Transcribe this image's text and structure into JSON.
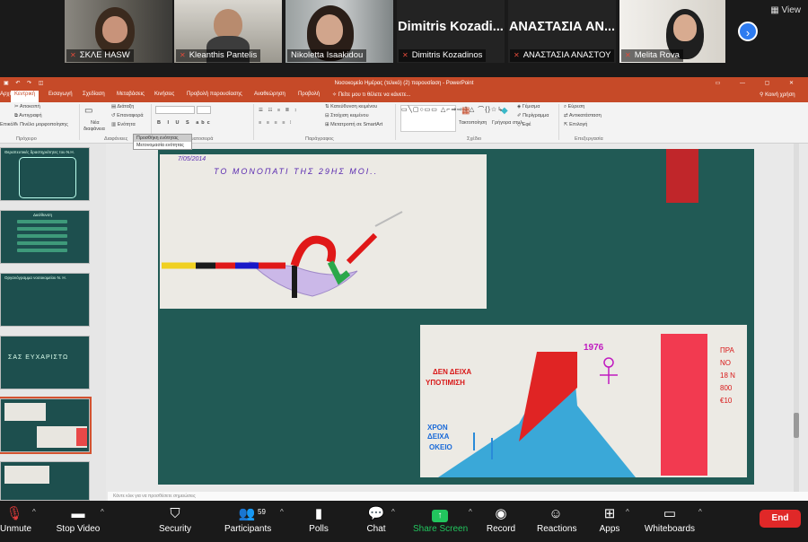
{
  "participants": [
    {
      "name": "ΣΚΛΕ HASW",
      "muted": true
    },
    {
      "name": "Kleanthis Pantelis",
      "muted": true
    },
    {
      "name": "Nikoletta Isaakidou",
      "muted": false,
      "active": true
    },
    {
      "name": "Dimitris Kozadinos",
      "muted": true,
      "display_name": "Dimitris  Kozadi..."
    },
    {
      "name": "ΑΝΑΣΤΑΣΙΑ ΑΝΑΣΤΟΥ",
      "muted": true,
      "display_name": "ΑΝΑΣΤΑΣΙΑ  ΑΝ..."
    },
    {
      "name": "Melita Rova",
      "muted": true
    }
  ],
  "strip": {
    "view_label": "View",
    "view_icon": "grid-icon",
    "next_icon": "chevron-right-icon"
  },
  "ppt": {
    "window_title": "Νοσοκομείο Ημέρας (τελικό) (2) παρουσίαση - PowerPoint",
    "tabs": [
      "Αρχείο",
      "Κεντρική",
      "Εισαγωγή",
      "Σχεδίαση",
      "Μεταβάσεις",
      "Κινήσεις",
      "Προβολή παρουσίασης",
      "Αναθεώρηση",
      "Προβολή"
    ],
    "selected_tab": "Κεντρική",
    "tell_me": "Πείτε μου τι θέλετε να κάνετε...",
    "share_label": "Κοινή χρήση",
    "ribbon": {
      "cut": "Αποκοπή",
      "copy": "Αντιγραφή",
      "format_painter": "Πινέλο μορφοποίησης",
      "paste": "Επικόλ.",
      "new_slide": "Νέα",
      "new_slide_2": "διαφάνεια",
      "layout": "Διάταξη",
      "reset": "Επαναφορά",
      "section": "Ενότητα",
      "text_direction": "Κατεύθυνση κειμένου",
      "align_text": "Στοίχιση κειμένου",
      "smartart": "Μετατροπή σε SmartArt",
      "arrange": "Τακτοποίηση",
      "quick_styles": "Γρήγορα στυλ",
      "fill": "Γέμισμα",
      "outline": "Περίγραμμα",
      "effects": "Εφέ",
      "find": "Εύρεση",
      "replace": "Αντικατάσταση",
      "select": "Επιλογή",
      "groups": [
        "Πρόχειρο",
        "Διαφάνειες",
        "Γραμματοσειρά",
        "Παράγραφος",
        "Σχέδιο",
        "Επεξεργασία"
      ]
    },
    "section_dropdown": [
      "Προσθήκη ενότητας",
      "Μετονομασία ενότητας"
    ],
    "thumbnails": [
      {
        "title": "Θεραπευτικές δραστηριότητες του Ν.Η."
      },
      {
        "title": "Διεύθυνση"
      },
      {
        "title": "Οργανόγραμμα νοσοκομείου Ν. Η."
      },
      {
        "title": "ΣΑΣ ΕΥΧΑΡΙΣΤΩ"
      },
      {
        "title": ""
      },
      {
        "title": ""
      }
    ],
    "notes_placeholder": "Κάντε κλικ για να προσθέσετε σημειώσεις",
    "slide": {
      "photo1_caption": "ΤΟ ΜΟΝΟΠΑΤΙ ΤΗΣ 29ΗΣ ΜΟΙ..",
      "photo1_date": "7/05/2014",
      "photo2_year": "1976",
      "photo2_text1": "ΔΕΝ ΔΕΙΧΑ",
      "photo2_text2": "ΥΠΟΤΙΜΙΣΗ",
      "photo2_text3": "ΧΡΟΝ",
      "photo2_text4": "ΔΕΙΧΑ",
      "photo2_text5": "ΟΚΕΙΟ",
      "photo2_side": [
        "ΠΡΑ",
        "ΝΟ",
        "18 Ν",
        "800",
        "€10"
      ]
    },
    "colors": {
      "accent": "#c64a28",
      "slide_bg": "#215a55",
      "thumb_bg": "#1d4f4e"
    }
  },
  "toolbar": {
    "unmute": "Unmute",
    "stop_video": "Stop Video",
    "security": "Security",
    "participants": "Participants",
    "participants_count": "59",
    "polls": "Polls",
    "chat": "Chat",
    "share_screen": "Share Screen",
    "record": "Record",
    "reactions": "Reactions",
    "apps": "Apps",
    "whiteboards": "Whiteboards",
    "end": "End",
    "colors": {
      "share": "#22c55e",
      "end": "#e02828"
    }
  }
}
